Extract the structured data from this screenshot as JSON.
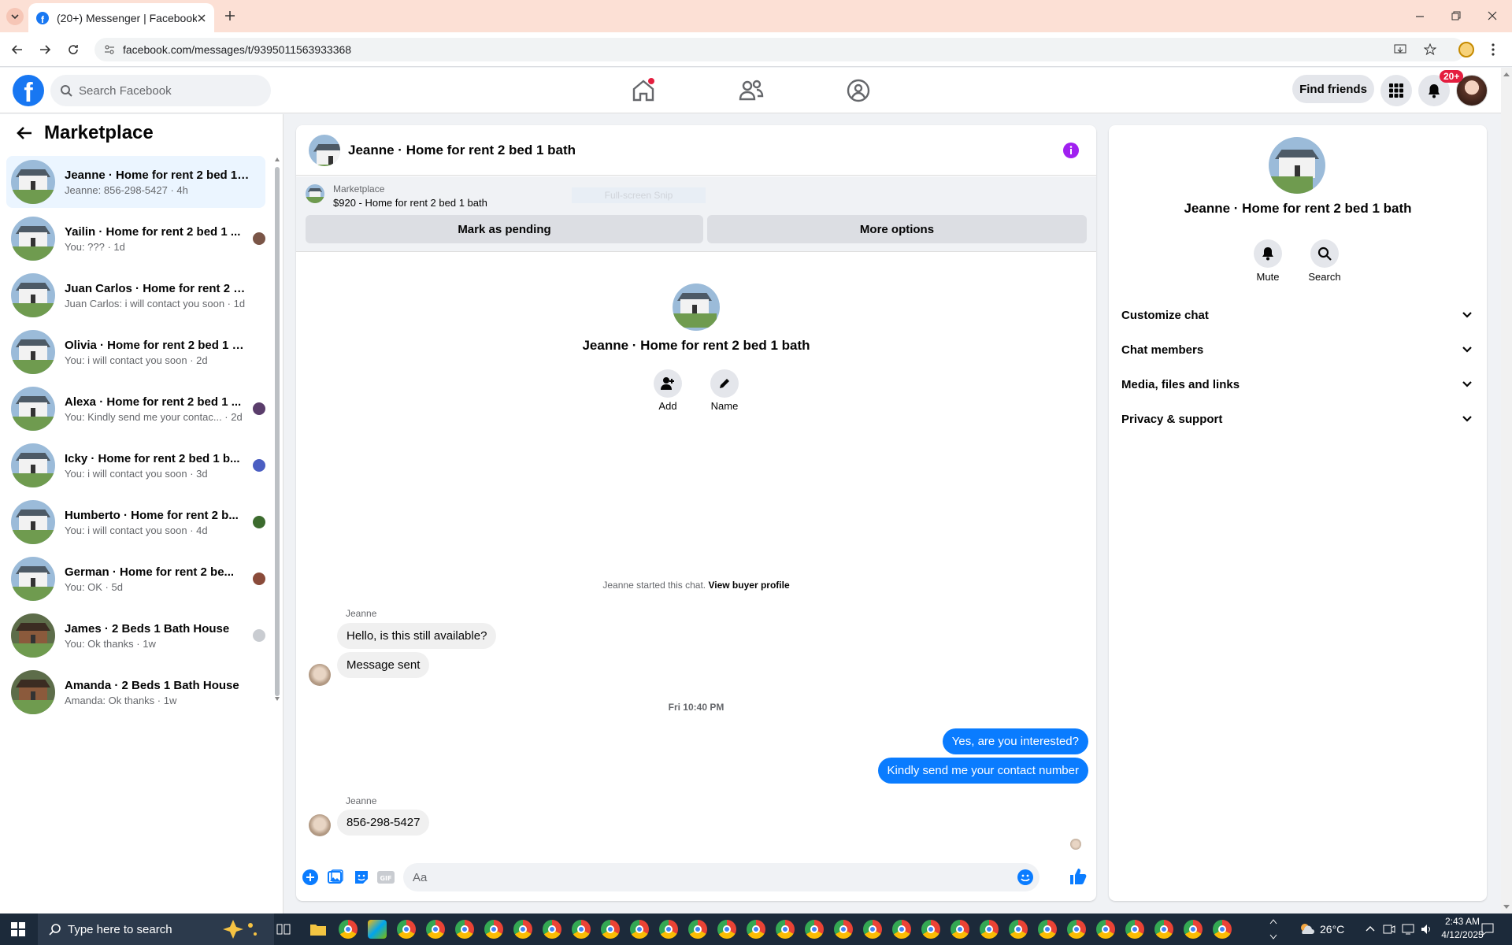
{
  "browser": {
    "tab_title": "(20+) Messenger | Facebook",
    "url": "facebook.com/messages/t/9395011563933368"
  },
  "header": {
    "search_placeholder": "Search Facebook",
    "find_friends": "Find friends",
    "notif_badge": "20+"
  },
  "sidebar": {
    "title": "Marketplace",
    "chats": [
      {
        "name": "Jeanne · Home for rent 2 bed 1 ...",
        "msg": "Jeanne: 856-298-5427 · 4h",
        "thumb": "house",
        "seen_color": ""
      },
      {
        "name": "Yailin · Home for rent 2 bed 1 ...",
        "msg": "You: ??? · 1d",
        "thumb": "house",
        "seen_color": "#7a5547"
      },
      {
        "name": "Juan Carlos · Home for rent 2 be...",
        "msg": "Juan Carlos: i will contact you soon · 1d",
        "thumb": "house",
        "seen_color": ""
      },
      {
        "name": "Olivia · Home for rent 2 bed 1 ba...",
        "msg": "You: i will contact you soon · 2d",
        "thumb": "house",
        "seen_color": ""
      },
      {
        "name": "Alexa · Home for rent 2 bed 1 ...",
        "msg": "You: Kindly send me your contac... · 2d",
        "thumb": "house",
        "seen_color": "#5a3d6b"
      },
      {
        "name": "Icky · Home for rent 2 bed 1 b...",
        "msg": "You: i will contact you soon · 3d",
        "thumb": "house",
        "seen_color": "#4b5ec2"
      },
      {
        "name": "Humberto · Home for rent 2 b...",
        "msg": "You: i will contact you soon · 4d",
        "thumb": "house",
        "seen_color": "#3c6b2e"
      },
      {
        "name": "German · Home for rent 2 be...",
        "msg": "You: OK · 5d",
        "thumb": "house",
        "seen_color": "#8a4b3a"
      },
      {
        "name": "James · 2 Beds 1 Bath House",
        "msg": "You: Ok thanks · 1w",
        "thumb": "brick",
        "seen_color": "#c9ccd1"
      },
      {
        "name": "Amanda · 2 Beds 1 Bath House",
        "msg": "Amanda: Ok thanks · 1w",
        "thumb": "brick",
        "seen_color": ""
      }
    ]
  },
  "chat": {
    "title": "Jeanne · Home for rent 2 bed 1 bath",
    "listing_source": "Marketplace",
    "listing": "$920 - Home for rent 2 bed 1 bath",
    "ghost_text": "Full-screen Snip",
    "mark_pending": "Mark as pending",
    "more_options": "More options",
    "profile_name": "Jeanne · Home for rent 2 bed 1 bath",
    "add_label": "Add",
    "name_label": "Name",
    "started_text": "Jeanne started this chat.",
    "view_buyer": "View buyer profile",
    "sender_1": "Jeanne",
    "msg_1": "Hello, is this still available?",
    "msg_2": "Message sent",
    "timestamp": "Fri 10:40 PM",
    "msg_3": "Yes, are you interested?",
    "msg_4": "Kindly send me your contact number",
    "sender_2": "Jeanne",
    "msg_5": "856-298-5427",
    "composer_placeholder": "Aa"
  },
  "details": {
    "name": "Jeanne · Home for rent 2 bed 1 bath",
    "mute": "Mute",
    "search": "Search",
    "sections": [
      "Customize chat",
      "Chat members",
      "Media, files and links",
      "Privacy & support"
    ]
  },
  "taskbar": {
    "search_placeholder": "Type here to search",
    "weather": "26°C",
    "time": "2:43 AM",
    "date": "4/12/2025"
  },
  "colors": {
    "brand": "#1877f2",
    "outgoing_bubble": "#0a7cff",
    "info_icon": "#a020f0"
  }
}
